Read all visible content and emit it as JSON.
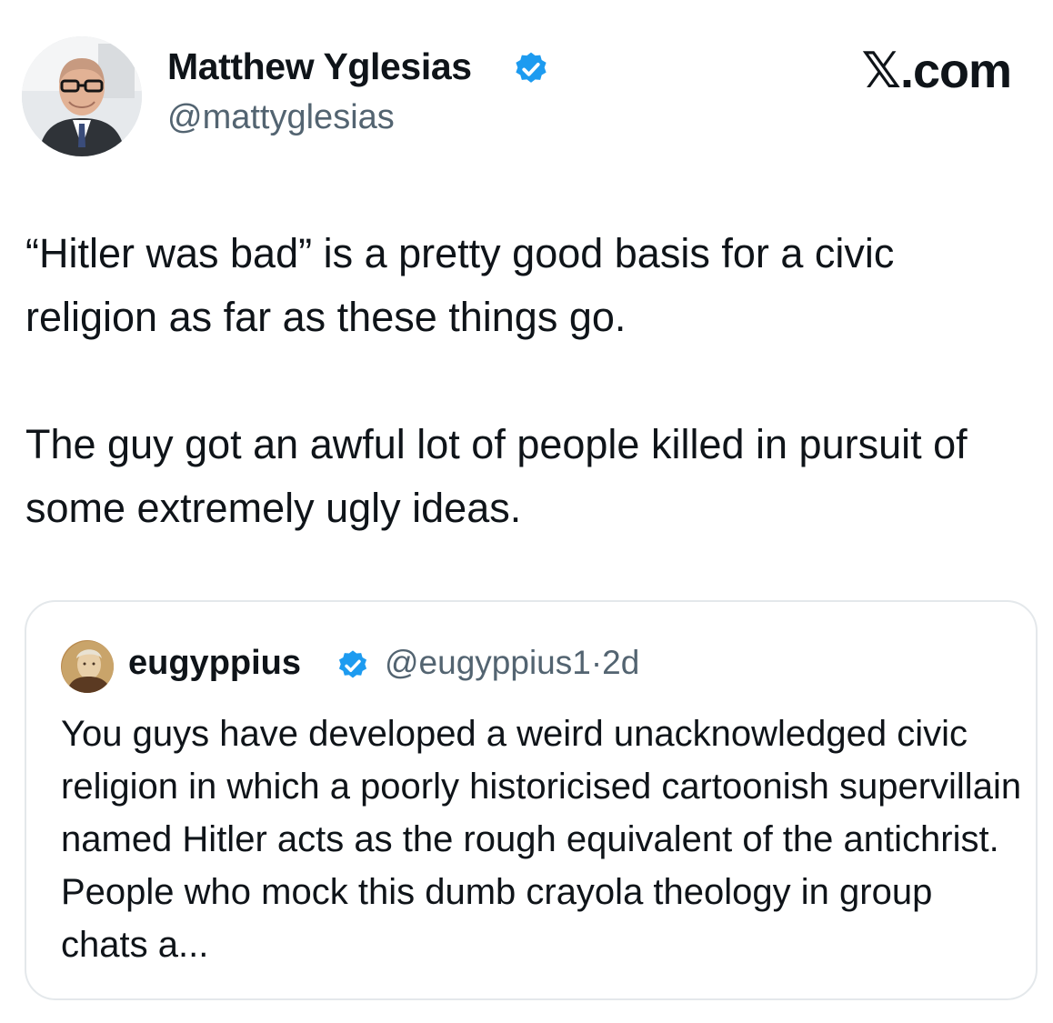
{
  "author": {
    "name": "Matthew Yglesias",
    "handle": "@mattyglesias",
    "verified": true,
    "avatar_icon": "profile-photo"
  },
  "brand": "𝕏.com",
  "tweet": {
    "text": "“Hitler was bad” is a pretty good basis for a civic religion as far as these things go.\n\nThe guy got an awful lot of people killed in pursuit of some extremely ugly ideas."
  },
  "quoted_tweet": {
    "name": "eugyppius",
    "handle": "@eugyppius1",
    "separator": "·",
    "time": "2d",
    "verified": true,
    "avatar_icon": "portrait-avatar",
    "text": "You guys have developed a weird unacknowledged civic religion in which a poorly historicised cartoonish supervillain named Hitler acts as the rough equivalent of the antichrist. People who mock this dumb crayola theology in group chats a..."
  },
  "colors": {
    "text": "#0f1419",
    "secondary": "#536471",
    "verified": "#1d9bf0",
    "border": "#e4e8eb"
  }
}
